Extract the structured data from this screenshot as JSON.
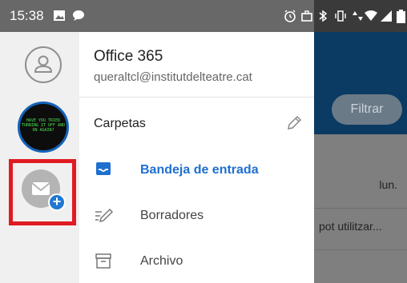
{
  "status_bar": {
    "time": "15:38"
  },
  "account": {
    "app_name": "Office 365",
    "email": "queraltcl@institutdelteatre.cat"
  },
  "rail": {
    "photo_text": "HAVE YOU TRIED TURNING IT OFF AND ON AGAIN?"
  },
  "folders": {
    "heading": "Carpetas",
    "items": [
      {
        "label": "Bandeja de entrada",
        "icon": "inbox-icon",
        "active": true
      },
      {
        "label": "Borradores",
        "icon": "drafts-icon",
        "active": false
      },
      {
        "label": "Archivo",
        "icon": "archive-icon",
        "active": false
      }
    ]
  },
  "background_app": {
    "filter_label": "Filtrar",
    "message_date": "lun.",
    "message_preview": "pot utilitzar..."
  },
  "colors": {
    "accent": "#1f6fcf",
    "highlight": "#e01b22",
    "header": "#0b3a63"
  }
}
